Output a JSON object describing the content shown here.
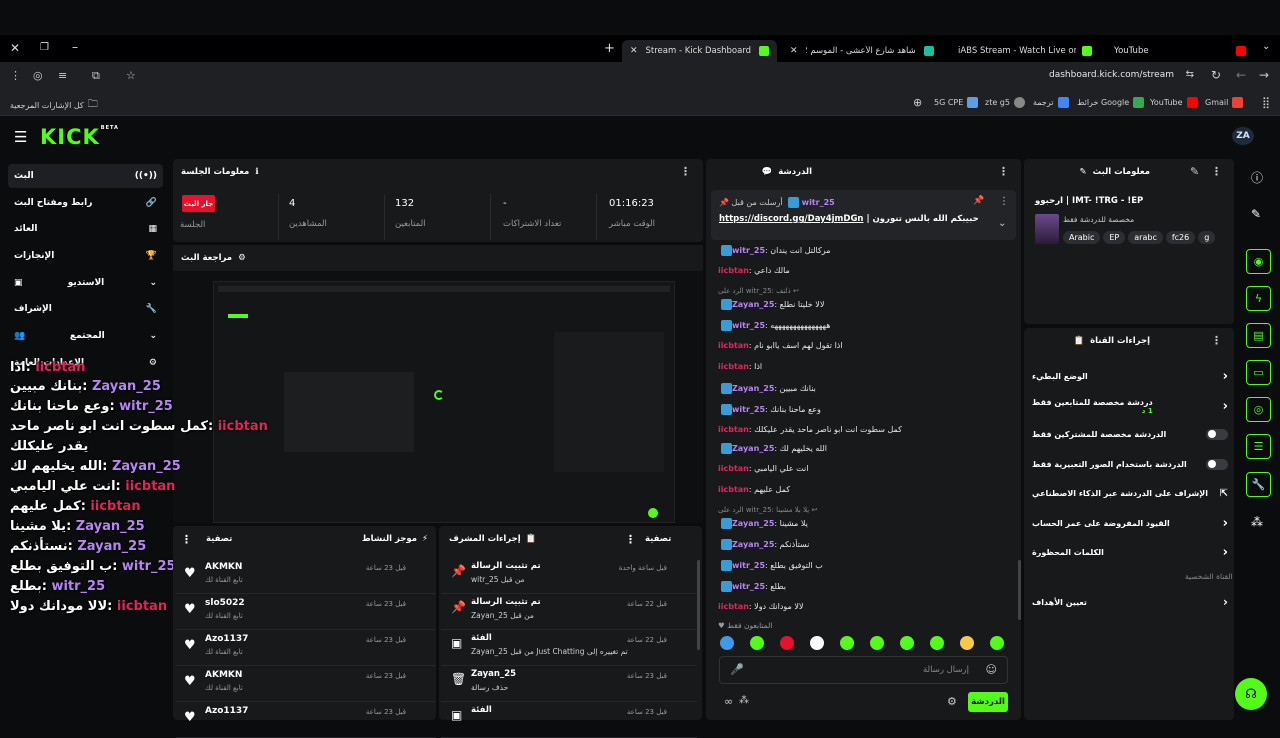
{
  "browser": {
    "tabs": [
      {
        "label": "YouTube",
        "color": "#ff0000"
      },
      {
        "label": "iABS Stream - Watch Live on Ki",
        "color": "#53fc18"
      },
      {
        "label": "شاهد شارع الأعشى - الموسم 2 |",
        "color": "#16c0a0"
      },
      {
        "label": "Stream - Kick Dashboard",
        "color": "#53fc18"
      }
    ],
    "url": "dashboard.kick.com/stream",
    "bookmarks": [
      "Gmail",
      "YouTube",
      "خرائط Google",
      "ترجمة",
      "zte g5",
      "5G CPE"
    ],
    "all_bookmarks": "كل الإشارات المرجعية"
  },
  "sidebar": {
    "items": [
      {
        "label": "البث"
      },
      {
        "label": "رابط ومفتاح البث"
      },
      {
        "label": "العائد"
      },
      {
        "label": "الإنجازات"
      },
      {
        "label": "الاستديو"
      },
      {
        "label": "الإشراف"
      },
      {
        "label": "المجتمع"
      },
      {
        "label": "الإعدادات العامة"
      }
    ]
  },
  "session": {
    "title": "معلومات الجلسة",
    "live_badge": "جار البث",
    "session_label": "الجلسة",
    "viewers_value": "4",
    "viewers_label": "المشاهدين",
    "followers_value": "132",
    "followers_label": "المتابعين",
    "subs_value": "-",
    "subs_label": "تعداد الاشتراكات",
    "time_value": "01:16:23",
    "time_label": "الوقت مباشر"
  },
  "preview": {
    "title": "مراجعة البث"
  },
  "overlay_chat": [
    {
      "user": "iicbtan",
      "text": "اذا",
      "color": "#e0245e"
    },
    {
      "user": "Zayan_25",
      "text": "بنانك مبيين",
      "color": "#b784f5"
    },
    {
      "user": "witr_25",
      "text": "وعع ماحنا بنانك",
      "color": "#b784f5"
    },
    {
      "user": "iicbtan",
      "text": "كمل سطوت انت ابو ناصر ماحد",
      "color": "#e0245e"
    },
    {
      "user": "",
      "text": "يقدر عليكلك",
      "color": "#fff"
    },
    {
      "user": "Zayan_25",
      "text": "الله يخليهم لك",
      "color": "#b784f5"
    },
    {
      "user": "iicbtan",
      "text": "انت علي اليامبي",
      "color": "#e0245e"
    },
    {
      "user": "iicbtan",
      "text": "كمل عليهم",
      "color": "#e0245e"
    },
    {
      "user": "Zayan_25",
      "text": "يلا مشينا",
      "color": "#b784f5"
    },
    {
      "user": "Zayan_25",
      "text": "نستأذنكم",
      "color": "#b784f5"
    },
    {
      "user": "witr_25",
      "text": "ب التوفيق بطلع",
      "color": "#b784f5"
    },
    {
      "user": "witr_25",
      "text": "بطلع",
      "color": "#b784f5"
    },
    {
      "user": "iicbtan",
      "text": "لالا مودانك دولا",
      "color": "#e0245e"
    }
  ],
  "activity": {
    "title": "موجز النشاط",
    "filter": "تصفية",
    "rows": [
      {
        "name": "AKMKN",
        "sub": "تابع القناة لك",
        "time": "قبل 23 ساعة"
      },
      {
        "name": "slo5022",
        "sub": "تابع القناة لك",
        "time": "قبل 23 ساعة"
      },
      {
        "name": "Azo1137",
        "sub": "تابع القناة لك",
        "time": "قبل 23 ساعة"
      },
      {
        "name": "AKMKN",
        "sub": "تابع القناة لك",
        "time": "قبل 23 ساعة"
      },
      {
        "name": "Azo1137",
        "sub": "",
        "time": "قبل 23 ساعة"
      }
    ]
  },
  "modactions": {
    "title": "إجراءات المشرف",
    "filter": "تصفية",
    "rows": [
      {
        "name": "تم تثبيت الرسالة",
        "sub": "من قبل witr_25",
        "time": "قبل ساعة واحدة"
      },
      {
        "name": "تم تثبيت الرسالة",
        "sub": "من قبل Zayan_25",
        "time": "قبل 22 ساعة"
      },
      {
        "name": "الفئة",
        "sub": "تم تغييره إلى Just Chatting من قبل Zayan_25",
        "time": "قبل 22 ساعة"
      },
      {
        "name": "Zayan_25",
        "sub": "حذف رسالة",
        "time": "قبل 23 ساعة"
      },
      {
        "name": "الفئة",
        "sub": "",
        "time": "قبل 23 ساعة"
      }
    ]
  },
  "chat": {
    "title": "الدردشة",
    "pinned_user": "witr_25",
    "pinned_by": "أرسلت من قبل",
    "pinned_text": "حبيبكم الله بالنس تنورون |",
    "pinned_link": "https://discord.gg/Day4jmDGn",
    "messages": [
      {
        "user": "witr_25",
        "text": "مركالتل انت يندان",
        "color": "#b784f5",
        "badge": true
      },
      {
        "user": "iicbtan",
        "text": "مالك داعي",
        "color": "#e0245e",
        "badge": false
      },
      {
        "reply": "الرد على witr_25: ذلتف"
      },
      {
        "user": "Zayan_25",
        "text": "لالا خليتا نطلع",
        "color": "#b784f5",
        "badge": true
      },
      {
        "user": "witr_25",
        "text": "هههههههههههههههه",
        "color": "#b784f5",
        "badge": true
      },
      {
        "user": "iicbtan",
        "text": "اذا تقول لهم اسف ياابو نام",
        "color": "#e0245e",
        "badge": false
      },
      {
        "user": "iicbtan",
        "text": "اذا",
        "color": "#e0245e",
        "badge": false
      },
      {
        "user": "Zayan_25",
        "text": "بنانك مبيين",
        "color": "#b784f5",
        "badge": true
      },
      {
        "user": "witr_25",
        "text": "وعع ماحنا بنانك",
        "color": "#b784f5",
        "badge": true
      },
      {
        "user": "iicbtan",
        "text": "كمل سطوت انت ابو ناصر ماحد يقدر عليكلك",
        "color": "#e0245e",
        "badge": false
      },
      {
        "user": "Zayan_25",
        "text": "الله يخليهم لك",
        "color": "#b784f5",
        "badge": true
      },
      {
        "user": "iicbtan",
        "text": "انت علي اليامبي",
        "color": "#e0245e",
        "badge": false
      },
      {
        "user": "iicbtan",
        "text": "كمل عليهم",
        "color": "#e0245e",
        "badge": false
      },
      {
        "reply": "الرد على witr_25: يلا بلا مشينا"
      },
      {
        "user": "Zayan_25",
        "text": "يلا مشينا",
        "color": "#b784f5",
        "badge": true
      },
      {
        "user": "Zayan_25",
        "text": "نستأذنكم",
        "color": "#b784f5",
        "badge": true
      },
      {
        "user": "witr_25",
        "text": "ب التوفيق بطلع",
        "color": "#b784f5",
        "badge": true
      },
      {
        "user": "witr_25",
        "text": "بطلع",
        "color": "#b784f5",
        "badge": true
      },
      {
        "user": "iicbtan",
        "text": "لالا مودانك دولا",
        "color": "#e0245e",
        "badge": false
      }
    ],
    "followers_only": "المتابعون فقط",
    "input_placeholder": "إرسال رسالة",
    "send_label": "الدردشة"
  },
  "stream_info": {
    "title": "معلومات البث",
    "stream_title": "ارحبوو | IMT- !TRG - !EP",
    "category": "مخصصة للدردشة فقط",
    "tags": [
      "Arabic",
      "EP",
      "arabc",
      "fc26",
      "g"
    ]
  },
  "channel_actions": {
    "title": "إجراءات القناة",
    "rows": [
      {
        "label": "الوضع البطيء",
        "kind": "chevron",
        "sub": ""
      },
      {
        "label": "دردشة مخصصة للمتابعين فقط",
        "kind": "chevron",
        "sub": "1 د"
      },
      {
        "label": "الدردشة مخصصة للمشتركين فقط",
        "kind": "toggle",
        "sub": ""
      },
      {
        "label": "الدردشة باستخدام الصور التعبيرية فقط",
        "kind": "toggle",
        "sub": ""
      },
      {
        "label": "الإشراف على الدردشة عبر الذكاء الاصطناعي",
        "kind": "ext",
        "sub": ""
      },
      {
        "label": "القيود المفروضة على عمر الحساب",
        "kind": "chevron",
        "sub": ""
      },
      {
        "label": "الكلمات المحظورة",
        "kind": "chevron",
        "sub": ""
      }
    ],
    "section": "القناة الشخصية",
    "goals": "تعيين الأهداف"
  },
  "colors": {
    "accent": "#53fc18",
    "live": "#e8112d"
  }
}
